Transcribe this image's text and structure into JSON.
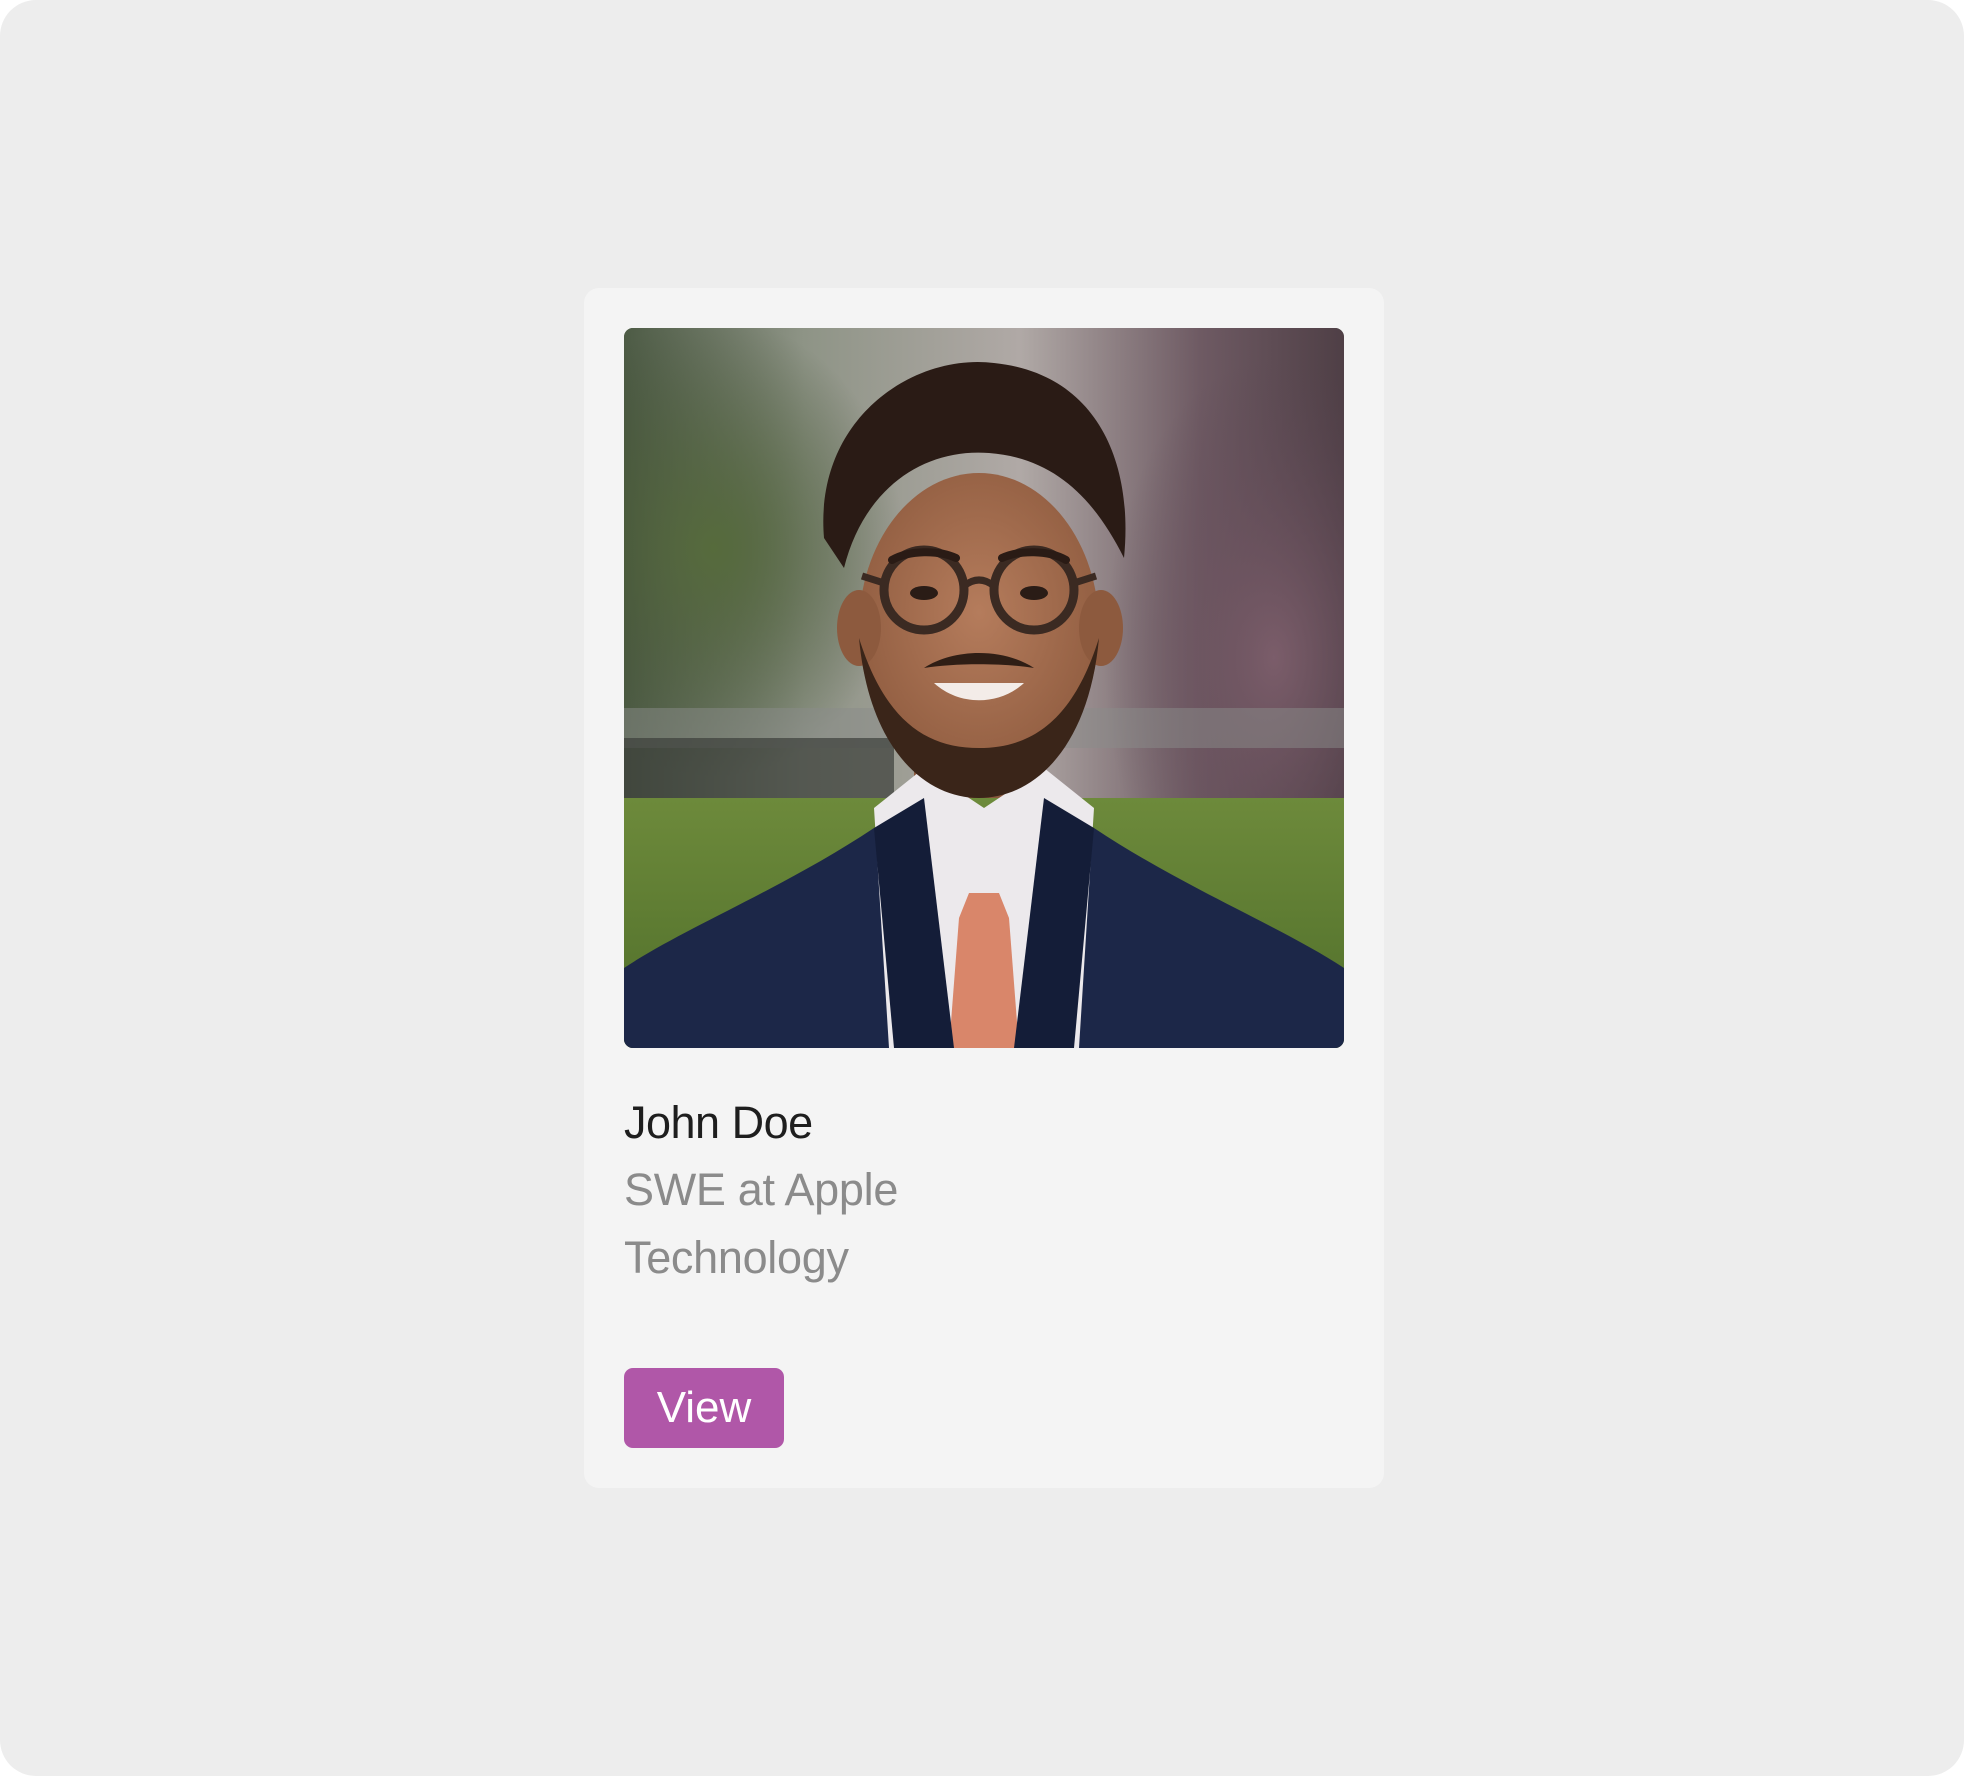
{
  "profile": {
    "name": "John Doe",
    "title": "SWE at Apple",
    "category": "Technology",
    "view_label": "View",
    "photo_alt": "John Doe"
  },
  "colors": {
    "page_background": "#ededed",
    "card_background": "#f4f4f4",
    "name_text": "#1e1e1e",
    "secondary_text": "#8b8b8b",
    "accent": "#b057a8"
  },
  "icons": {
    "photo": "portrait-photo"
  }
}
